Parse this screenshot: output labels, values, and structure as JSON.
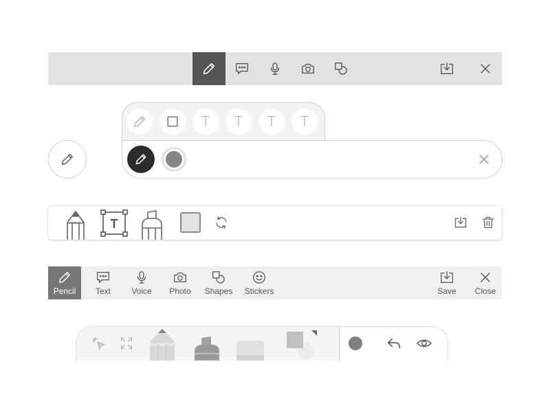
{
  "toolbar1": {
    "tools": [
      {
        "name": "pencil",
        "icon": "pencil-icon",
        "active": true
      },
      {
        "name": "text",
        "icon": "speech-bubble-icon",
        "active": false
      },
      {
        "name": "voice",
        "icon": "microphone-icon",
        "active": false
      },
      {
        "name": "photo",
        "icon": "camera-icon",
        "active": false
      },
      {
        "name": "shapes",
        "icon": "shapes-icon",
        "active": false
      }
    ],
    "actions": [
      {
        "name": "save",
        "icon": "download-icon"
      },
      {
        "name": "close",
        "icon": "close-icon"
      }
    ],
    "active_color": "#555555",
    "bar_color": "#e2e2e2"
  },
  "floating_button": {
    "icon": "pencil-icon"
  },
  "panel2": {
    "top_row": [
      {
        "name": "pencil",
        "icon": "pencil-icon",
        "glyph": ""
      },
      {
        "name": "rectangle",
        "icon": "square-icon",
        "glyph": ""
      },
      {
        "name": "text-1",
        "icon": "text-t-icon",
        "glyph": "T"
      },
      {
        "name": "text-2",
        "icon": "text-t-icon",
        "glyph": "T"
      },
      {
        "name": "text-3",
        "icon": "text-t-icon",
        "glyph": "T"
      },
      {
        "name": "text-4",
        "icon": "text-t-icon",
        "glyph": "T"
      }
    ],
    "bottom_row": {
      "active_tool_icon": "pencil-icon",
      "color_swatch": "#858585",
      "close_icon": "close-icon"
    }
  },
  "toolbar3": {
    "tools": [
      {
        "name": "pencil",
        "icon": "pencil-illustration-icon"
      },
      {
        "name": "text",
        "icon": "text-frame-icon",
        "glyph": "T"
      },
      {
        "name": "marker",
        "icon": "marker-illustration-icon"
      }
    ],
    "swatch_color": "#e2e2e2",
    "actions": [
      {
        "name": "rotate",
        "icon": "refresh-icon"
      },
      {
        "name": "save",
        "icon": "download-icon"
      },
      {
        "name": "delete",
        "icon": "trash-icon"
      }
    ]
  },
  "toolbar4": {
    "tools": [
      {
        "name": "pencil",
        "label": "Pencil",
        "icon": "pencil-icon",
        "active": true
      },
      {
        "name": "text",
        "label": "Text",
        "icon": "speech-bubble-icon",
        "active": false
      },
      {
        "name": "voice",
        "label": "Voice",
        "icon": "microphone-icon",
        "active": false
      },
      {
        "name": "photo",
        "label": "Photo",
        "icon": "camera-icon",
        "active": false
      },
      {
        "name": "shapes",
        "label": "Shapes",
        "icon": "shapes-icon",
        "active": false
      },
      {
        "name": "stickers",
        "label": "Stickers",
        "icon": "smiley-icon",
        "active": false
      }
    ],
    "actions": [
      {
        "name": "save",
        "label": "Save",
        "icon": "download-icon"
      },
      {
        "name": "close",
        "label": "Close",
        "icon": "close-icon"
      }
    ],
    "active_color": "#777777"
  },
  "toolbar5": {
    "tools": [
      {
        "name": "select",
        "icon": "cursor-select-icon"
      },
      {
        "name": "expand",
        "icon": "expand-icon"
      },
      {
        "name": "pencil",
        "icon": "pencil-illustration-icon"
      },
      {
        "name": "marker",
        "icon": "marker-illustration-icon"
      },
      {
        "name": "eraser",
        "icon": "eraser-illustration-icon"
      },
      {
        "name": "shapes",
        "icon": "shapes-illustration-icon"
      }
    ],
    "color_dot": "#808080",
    "actions": [
      {
        "name": "undo",
        "icon": "undo-icon"
      },
      {
        "name": "preview",
        "icon": "eye-icon"
      }
    ]
  }
}
